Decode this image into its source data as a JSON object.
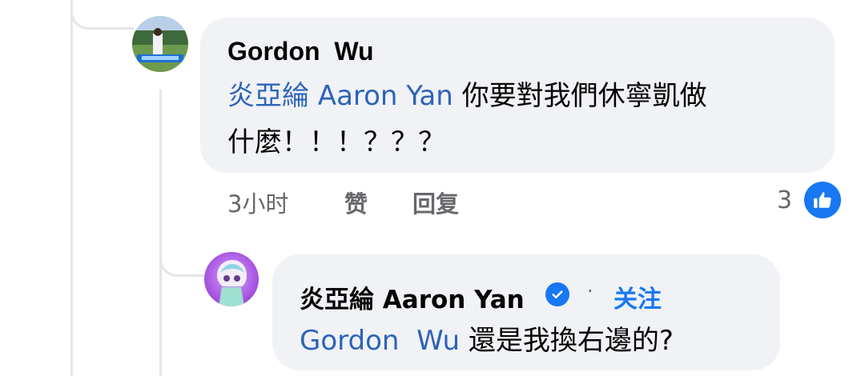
{
  "comment": {
    "author": "Gordon  Wu",
    "mention": "炎亞綸 Aaron Yan",
    "text_line1_rest": " 你要對我們休寧凱做",
    "text_line2": "什麼！！！？？？",
    "time": "3小时",
    "like_label": "赞",
    "reply_label": "回复",
    "reaction_count": "3"
  },
  "reply": {
    "author": "炎亞綸 Aaron Yan",
    "separator": "·",
    "follow_label": "关注",
    "mention": "Gordon  Wu",
    "text_rest": " 還是我換右邊的?"
  },
  "colors": {
    "bubble": "#f0f2f5",
    "mention": "#2d63b8",
    "link": "#1877f2",
    "meta": "#65676b"
  },
  "icons": {
    "verified": "verified-check-icon",
    "like": "thumbs-up-icon"
  }
}
